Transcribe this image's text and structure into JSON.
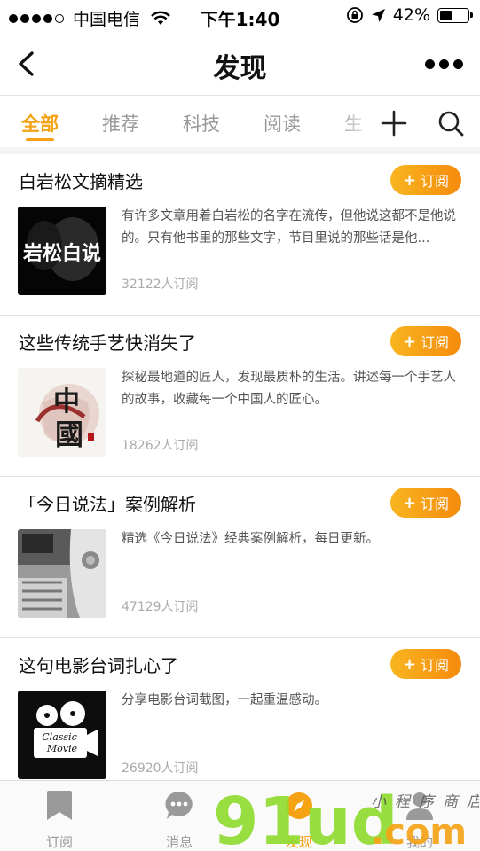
{
  "status_bar": {
    "carrier": "中国电信",
    "time": "下午1:40",
    "battery_percent": "42%",
    "battery_level": 0.42
  },
  "nav": {
    "title": "发现"
  },
  "tabs": [
    {
      "label": "全部",
      "active": true
    },
    {
      "label": "推荐",
      "active": false
    },
    {
      "label": "科技",
      "active": false
    },
    {
      "label": "阅读",
      "active": false
    },
    {
      "label": "生",
      "active": false
    }
  ],
  "subscribe_label": "订阅",
  "items": [
    {
      "title": "白岩松文摘精选",
      "description": "有许多文章用着白岩松的名字在流传，但他说这都不是他说的。只有他书里的那些文字，节目里说的那些话是他...",
      "subscribers": "32122人订阅",
      "thumb_text": "岩松白说"
    },
    {
      "title": "这些传统手艺快消失了",
      "description": "探秘最地道的匠人，发现最质朴的生活。讲述每一个手艺人的故事，收藏每一个中国人的匠心。",
      "subscribers": "18262人订阅",
      "thumb_text": "中國"
    },
    {
      "title": "「今日说法」案例解析",
      "description": "精选《今日说法》经典案例解析，每日更新。",
      "subscribers": "47129人订阅"
    },
    {
      "title": "这句电影台词扎心了",
      "description": "分享电影台词截图，一起重温感动。",
      "subscribers": "26920人订阅",
      "thumb_text": "Classic Movie"
    }
  ],
  "tab_bar": [
    {
      "label": "订阅",
      "icon": "bookmark-icon",
      "active": false
    },
    {
      "label": "消息",
      "icon": "chat-bubble-icon",
      "active": false
    },
    {
      "label": "发现",
      "icon": "discover-icon",
      "active": true
    },
    {
      "label": "我的",
      "icon": "person-icon",
      "active": false
    }
  ],
  "watermark": {
    "brand": "91ud.com",
    "tagline": "小程序商店"
  },
  "colors": {
    "accent": "#f5a313",
    "button_gradient_start": "#f8b51f",
    "button_gradient_end": "#f58b0d",
    "watermark_green": "#8fdb2e",
    "watermark_orange": "#f5a313"
  }
}
